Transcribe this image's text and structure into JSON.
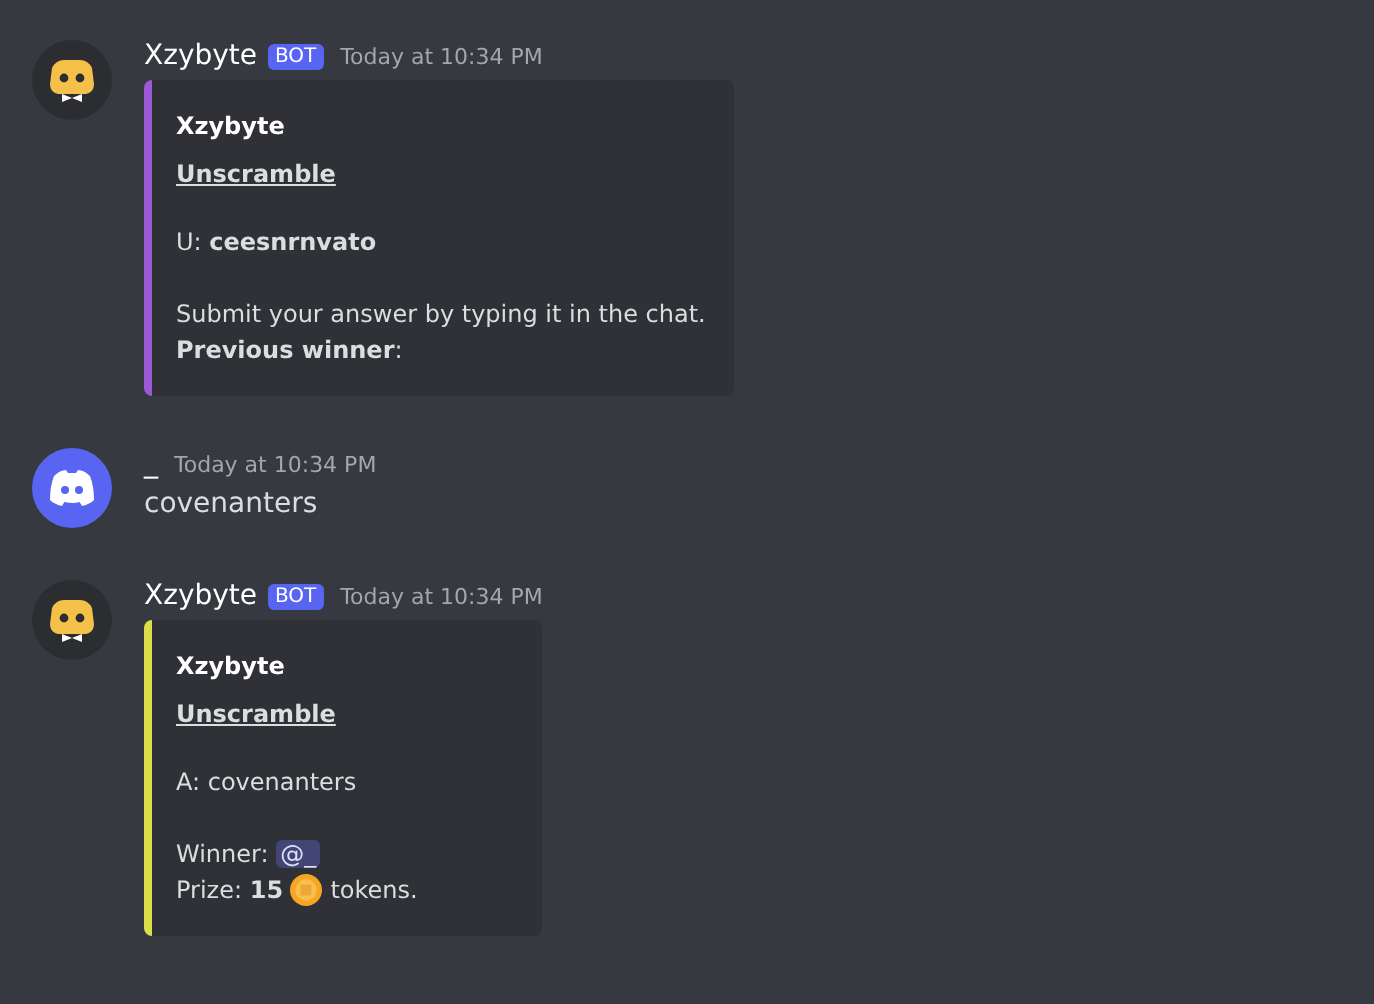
{
  "messages": [
    {
      "kind": "embed",
      "avatar": {
        "kind": "bot"
      },
      "author": "Xzybyte",
      "badge": "BOT",
      "time": "Today at 10:34 PM",
      "embed": {
        "color": "#9b59d6",
        "title": "Xzybyte",
        "link": "Unscramble",
        "paragraphs": [
          [
            [
              {
                "kind": "text",
                "text": "U: **ceesnrnvato**"
              }
            ]
          ],
          [
            [
              {
                "kind": "text",
                "text": "Submit your answer by typing it in the chat."
              }
            ],
            [
              {
                "kind": "text",
                "text": "**Previous winner**:"
              }
            ]
          ]
        ]
      }
    },
    {
      "kind": "text",
      "avatar": {
        "kind": "user"
      },
      "author": "_",
      "time": "Today at 10:34 PM",
      "text": "covenanters"
    },
    {
      "kind": "embed",
      "avatar": {
        "kind": "bot"
      },
      "author": "Xzybyte",
      "badge": "BOT",
      "time": "Today at 10:34 PM",
      "embed": {
        "color": "#dbe04a",
        "title": "Xzybyte",
        "link": "Unscramble",
        "paragraphs": [
          [
            [
              {
                "kind": "text",
                "text": "A: covenanters"
              }
            ]
          ],
          [
            [
              {
                "kind": "text",
                "text": "Winner: "
              },
              {
                "kind": "mention",
                "text": "@_"
              }
            ],
            [
              {
                "kind": "text",
                "text": "Prize: **15** "
              },
              {
                "kind": "coin"
              },
              {
                "kind": "text",
                "text": " tokens."
              }
            ]
          ]
        ]
      }
    }
  ]
}
